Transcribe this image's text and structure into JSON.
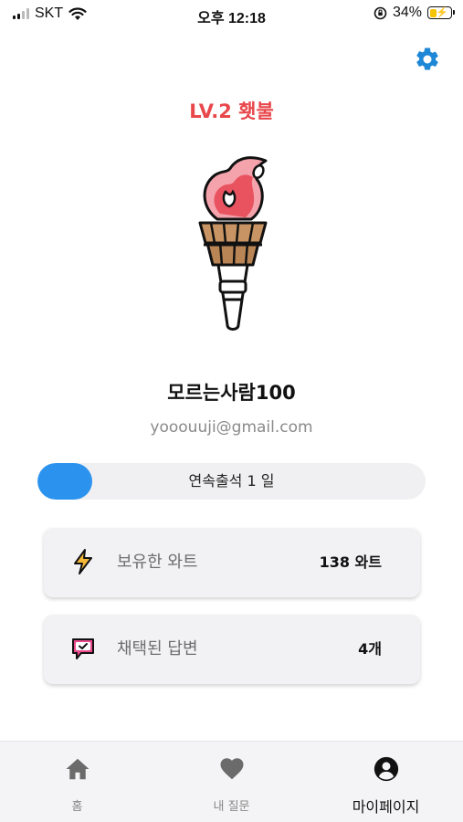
{
  "status_bar": {
    "carrier": "SKT",
    "time": "오후 12:18",
    "battery": "34%",
    "battery_level": 0.34
  },
  "profile": {
    "level_title": "LV.2 횃불",
    "level_color": "#e8474c",
    "avatar_icon": "torch-icon",
    "username": "모르는사람100",
    "email": "yooouuji@gmail.com"
  },
  "attendance": {
    "label": "연속출석 1 일",
    "progress": 0.14,
    "accent": "#2b93ee"
  },
  "cards": {
    "watt": {
      "icon": "lightning-icon",
      "title": "보유한 와트",
      "value": "138 와트"
    },
    "answers": {
      "icon": "chat-check-icon",
      "title": "채택된 답변",
      "value": "4개"
    }
  },
  "nav": {
    "home": {
      "icon": "home-icon",
      "label": "홈"
    },
    "my_questions": {
      "icon": "heart-icon",
      "label": "내 질문"
    },
    "mypage": {
      "icon": "user-icon",
      "label": "마이페이지"
    }
  },
  "colors": {
    "settings_icon": "#1e88d6",
    "nav_inactive": "#6b6b6b",
    "nav_active": "#111111"
  }
}
